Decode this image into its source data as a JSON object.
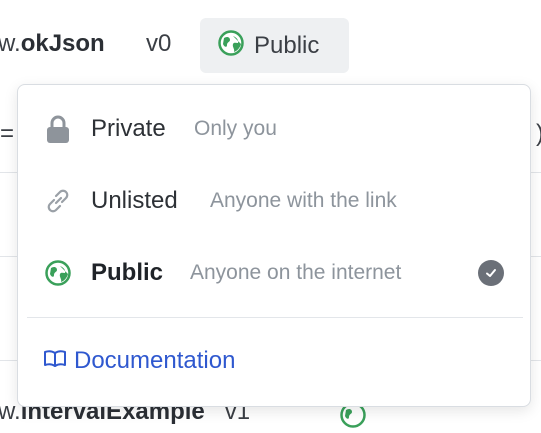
{
  "header": {
    "name_prefix": "w.",
    "name_bold": "okJson",
    "version": "v0",
    "visibility_button_label": "Public"
  },
  "background": {
    "left_edge_text": "=",
    "right_edge_text": ")",
    "bottom_prefix": "w.",
    "bottom_name": "intervalExample",
    "bottom_version": "v1"
  },
  "dropdown": {
    "options": [
      {
        "title": "Private",
        "description": "Only you",
        "icon": "lock-icon",
        "selected": false
      },
      {
        "title": "Unlisted",
        "description": "Anyone with the link",
        "icon": "link-icon",
        "selected": false
      },
      {
        "title": "Public",
        "description": "Anyone on the internet",
        "icon": "globe-icon",
        "selected": true
      }
    ],
    "documentation_label": "Documentation"
  },
  "colors": {
    "globe": "#3aa05a",
    "link": "#2f58cf",
    "check": "#6b7078"
  }
}
